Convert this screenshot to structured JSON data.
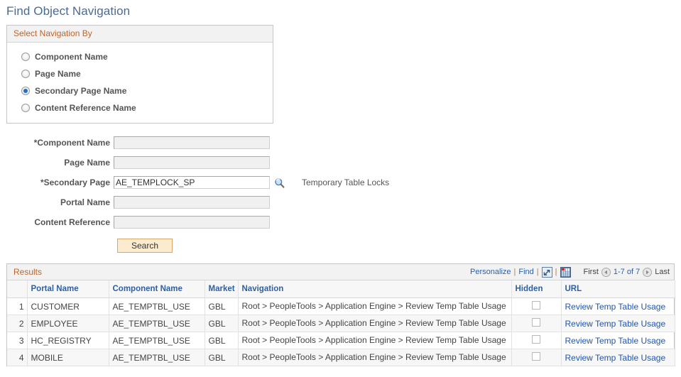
{
  "page": {
    "title": "Find Object Navigation"
  },
  "colors": {
    "title_blue": "#4b6a91",
    "header_orange": "#c0632a",
    "link_blue": "#2e5fa3",
    "url_blue": "#1f55b5",
    "button_bg": "#fbeccf",
    "button_border": "#d6a86a",
    "panel_bg": "#f2f2f2",
    "radio_dot": "#1f6fc4"
  },
  "select_navigation_by": {
    "header": "Select Navigation By",
    "options": [
      {
        "label": "Component Name",
        "selected": false
      },
      {
        "label": "Page Name",
        "selected": false
      },
      {
        "label": "Secondary Page Name",
        "selected": true
      },
      {
        "label": "Content Reference Name",
        "selected": false
      }
    ]
  },
  "search_form": {
    "fields": [
      {
        "label": "*Component Name",
        "value": "",
        "placeholder": "",
        "enabled": false,
        "lookup": false
      },
      {
        "label": "Page Name",
        "value": "",
        "placeholder": "",
        "enabled": false,
        "lookup": false
      },
      {
        "label": "*Secondary Page",
        "value": "AE_TEMPLOCK_SP",
        "placeholder": "",
        "enabled": true,
        "lookup": true,
        "prompt_text": "Temporary Table Locks"
      },
      {
        "label": "Portal Name",
        "value": "",
        "placeholder": "",
        "enabled": false,
        "lookup": false
      },
      {
        "label": "Content Reference",
        "value": "",
        "placeholder": "",
        "enabled": false,
        "lookup": false
      }
    ],
    "search_button": "Search"
  },
  "results": {
    "title": "Results",
    "toolbar": {
      "personalize": "Personalize",
      "find": "Find",
      "separator": "|",
      "zoom_icon": "expand-grid-icon",
      "download_icon": "download-spreadsheet-icon"
    },
    "pager": {
      "first": "First",
      "prev_icon": "previous-page-icon",
      "range": "1-7 of 7",
      "next_icon": "next-page-icon",
      "last": "Last"
    },
    "columns": [
      {
        "key": "seq",
        "label": ""
      },
      {
        "key": "portal_name",
        "label": "Portal Name"
      },
      {
        "key": "component_name",
        "label": "Component Name"
      },
      {
        "key": "market",
        "label": "Market"
      },
      {
        "key": "navigation",
        "label": "Navigation"
      },
      {
        "key": "hidden",
        "label": "Hidden"
      },
      {
        "key": "url",
        "label": "URL"
      }
    ],
    "rows": [
      {
        "seq": "1",
        "portal_name": "CUSTOMER",
        "component_name": "AE_TEMPTBL_USE",
        "market": "GBL",
        "navigation": "Root > PeopleTools > Application Engine > Review Temp Table Usage",
        "hidden": false,
        "url": "Review Temp Table Usage"
      },
      {
        "seq": "2",
        "portal_name": "EMPLOYEE",
        "component_name": "AE_TEMPTBL_USE",
        "market": "GBL",
        "navigation": "Root > PeopleTools > Application Engine > Review Temp Table Usage",
        "hidden": false,
        "url": "Review Temp Table Usage"
      },
      {
        "seq": "3",
        "portal_name": "HC_REGISTRY",
        "component_name": "AE_TEMPTBL_USE",
        "market": "GBL",
        "navigation": "Root > PeopleTools > Application Engine > Review Temp Table Usage",
        "hidden": false,
        "url": "Review Temp Table Usage"
      },
      {
        "seq": "4",
        "portal_name": "MOBILE",
        "component_name": "AE_TEMPTBL_USE",
        "market": "GBL",
        "navigation": "Root > PeopleTools > Application Engine > Review Temp Table Usage",
        "hidden": false,
        "url": "Review Temp Table Usage"
      }
    ]
  }
}
